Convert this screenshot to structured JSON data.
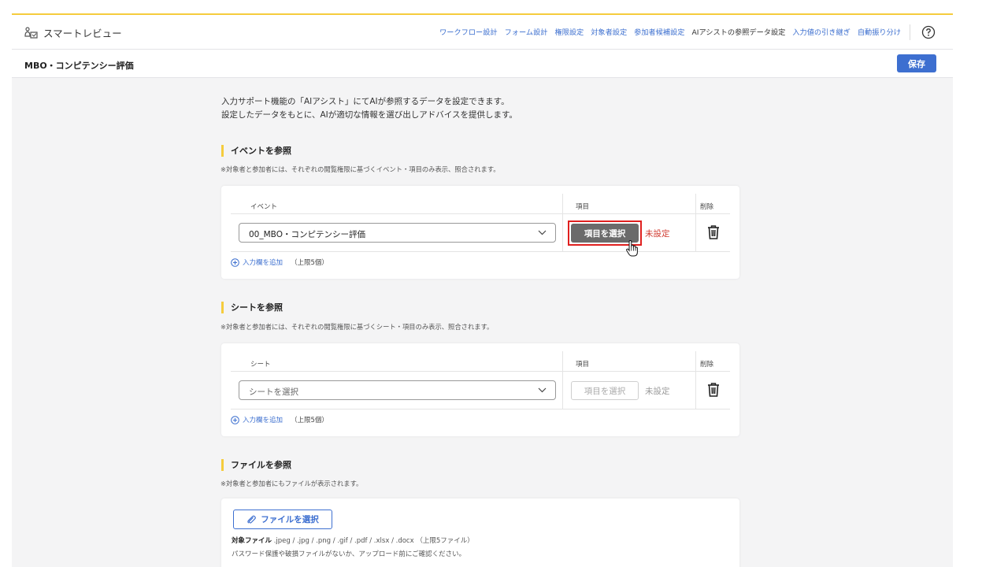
{
  "brand": {
    "name": "スマートレビュー"
  },
  "nav": {
    "items": [
      "ワークフロー設計",
      "フォーム設計",
      "権限設定",
      "対象者設定",
      "参加者候補設定",
      "AIアシストの参照データ設定",
      "入力値の引き継ぎ",
      "自動振り分け"
    ]
  },
  "page": {
    "title": "MBO・コンピテンシー評価",
    "save_label": "保存"
  },
  "intro": {
    "line1": "入力サポート機能の「AIアシスト」にてAIが参照するデータを設定できます。",
    "line2": "設定したデータをもとに、AIが適切な情報を選び出しアドバイスを提供します。"
  },
  "event_section": {
    "title": "イベントを参照",
    "note": "※対象者と参加者には、それぞれの閲覧権限に基づくイベント・項目のみ表示、照合されます。",
    "col_event": "イベント",
    "col_item": "項目",
    "col_delete": "削除",
    "selected_event": "00_MBO・コンピテンシー評価",
    "item_button": "項目を選択",
    "status": "未設定",
    "add_label": "入力欄を追加",
    "add_limit": "（上限5個）"
  },
  "sheet_section": {
    "title": "シートを参照",
    "note": "※対象者と参加者には、それぞれの閲覧権限に基づくシート・項目のみ表示、照合されます。",
    "col_sheet": "シート",
    "col_item": "項目",
    "col_delete": "削除",
    "placeholder": "シートを選択",
    "item_button": "項目を選択",
    "status": "未設定",
    "add_label": "入力欄を追加",
    "add_limit": "（上限5個）"
  },
  "file_section": {
    "title": "ファイルを参照",
    "note": "※対象者と参加者にもファイルが表示されます。",
    "button": "ファイルを選択",
    "types_label": "対象ファイル",
    "types": ".jpeg / .jpg / .png / .gif / .pdf / .xlsx / .docx",
    "limit": "（上限5ファイル）",
    "warning": "パスワード保護や破損ファイルがないか、アップロード前にご確認ください。"
  },
  "colors": {
    "accent": "#3d6fd0",
    "brand_yellow": "#f5cc3d",
    "alert_red": "#d03a2f",
    "highlight": "#e0201f"
  }
}
